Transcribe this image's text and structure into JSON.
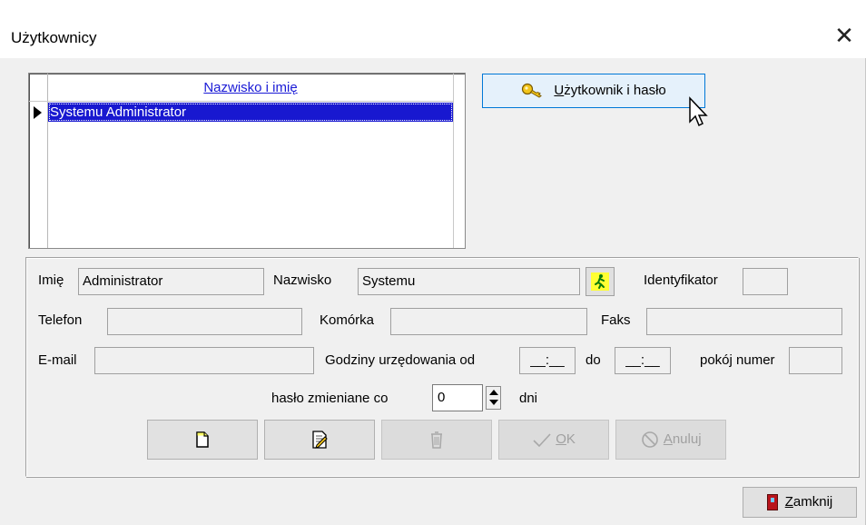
{
  "window": {
    "title": "Użytkownicy",
    "close_glyph": "✕"
  },
  "grid": {
    "header": "Nazwisko i imię",
    "rows": [
      "Systemu Administrator"
    ]
  },
  "user_button": {
    "label_prefix": "",
    "label_underlined": "U",
    "label_rest": "żytkownik i hasło",
    "icon": "key-icon"
  },
  "form": {
    "first_name_label": "Imię",
    "first_name_value": "Administrator",
    "last_name_label": "Nazwisko",
    "last_name_value": "Systemu",
    "identifier_label": "Identyfikator",
    "identifier_value": "",
    "phone_label": "Telefon",
    "phone_value": "",
    "mobile_label": "Komórka",
    "mobile_value": "",
    "fax_label": "Faks",
    "fax_value": "",
    "email_label": "E-mail",
    "email_value": "",
    "hours_from_label": "Godziny urzędowania od",
    "hours_from_value": "__:__",
    "hours_to_label": "do",
    "hours_to_value": "__:__",
    "room_label": "pokój numer",
    "room_value": "",
    "password_change_label": "hasło zmieniane co",
    "password_change_value": "0",
    "password_change_unit": "dni"
  },
  "toolbar": {
    "new_icon": "new-document-icon",
    "edit_icon": "edit-document-icon",
    "delete_icon": "trash-icon",
    "ok_underlined": "O",
    "ok_rest": "K",
    "cancel_underlined": "A",
    "cancel_rest": "nuluj"
  },
  "close_button": {
    "underlined": "Z",
    "rest": "amknij",
    "icon": "door-icon"
  },
  "colors": {
    "selection": "#1818d0",
    "link": "#1a1ad6",
    "hover_border": "#0078d7",
    "hover_bg": "#e5f1fb"
  }
}
